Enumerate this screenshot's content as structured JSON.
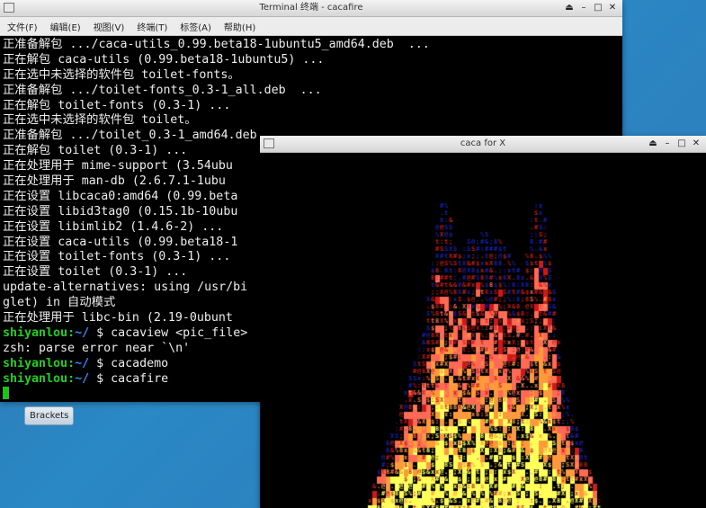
{
  "terminal": {
    "title": "Terminal 终端 - cacafire",
    "menu": [
      "文件(F)",
      "编辑(E)",
      "视图(V)",
      "终端(T)",
      "标签(A)",
      "帮助(H)"
    ],
    "lines": [
      [
        {
          "t": "正准备解包 .../caca-utils_0.99.beta18-1ubuntu5_amd64.deb  ..."
        }
      ],
      [
        {
          "t": "正在解包 caca-utils (0.99.beta18-1ubuntu5) ..."
        }
      ],
      [
        {
          "t": "正在选中未选择的软件包 toilet-fonts。"
        }
      ],
      [
        {
          "t": "正准备解包 .../toilet-fonts_0.3-1_all.deb  ..."
        }
      ],
      [
        {
          "t": "正在解包 toilet-fonts (0.3-1) ..."
        }
      ],
      [
        {
          "t": "正在选中未选择的软件包 toilet。"
        }
      ],
      [
        {
          "t": "正准备解包 .../toilet_0.3-1_amd64.deb"
        }
      ],
      [
        {
          "t": "正在解包 toilet (0.3-1) ..."
        }
      ],
      [
        {
          "t": "正在处理用于 mime-support (3.54ubu"
        }
      ],
      [
        {
          "t": "正在处理用于 man-db (2.6.7.1-1ubu"
        }
      ],
      [
        {
          "t": "正在设置 libcaca0:amd64 (0.99.beta"
        }
      ],
      [
        {
          "t": "正在设置 libid3tag0 (0.15.1b-10ubu"
        }
      ],
      [
        {
          "t": "正在设置 libimlib2 (1.4.6-2) ..."
        }
      ],
      [
        {
          "t": "正在设置 caca-utils (0.99.beta18-1"
        }
      ],
      [
        {
          "t": "正在设置 toilet-fonts (0.3-1) ..."
        }
      ],
      [
        {
          "t": "正在设置 toilet (0.3-1) ..."
        }
      ],
      [
        {
          "t": "update-alternatives: using /usr/bi"
        }
      ],
      [
        {
          "t": "glet) in 自动模式"
        }
      ],
      [
        {
          "t": "正在处理用于 libc-bin (2.19-0ubunt"
        }
      ],
      [
        {
          "t": "shiyanlou",
          "c": "prompt"
        },
        {
          "t": ":",
          "c": "prompt"
        },
        {
          "t": "~/",
          "c": "tilde"
        },
        {
          "t": " $ cacaview <pic_file>"
        }
      ],
      [
        {
          "t": "zsh: parse error near `\\n'"
        }
      ],
      [
        {
          "t": "shiyanlou",
          "c": "prompt"
        },
        {
          "t": ":",
          "c": "prompt"
        },
        {
          "t": "~/",
          "c": "tilde"
        },
        {
          "t": " $ cacademo"
        }
      ],
      [
        {
          "t": "shiyanlou",
          "c": "prompt"
        },
        {
          "t": ":",
          "c": "prompt"
        },
        {
          "t": "~/",
          "c": "tilde"
        },
        {
          "t": " $ cacafire"
        }
      ]
    ],
    "colors": {
      "prompt": "#1fd11f",
      "path": "#2e8bff",
      "text": "#ededed",
      "cursor": "#14c814"
    }
  },
  "caca": {
    "title": "caca for X",
    "fire_colors": {
      "blue": "#1a22b8",
      "red": "#cc1a1a",
      "salmon": "#ff6a55",
      "orange": "#ff9a3c",
      "yellow": "#ffff5a"
    }
  },
  "taskbar": {
    "brackets_label": "Brackets"
  }
}
